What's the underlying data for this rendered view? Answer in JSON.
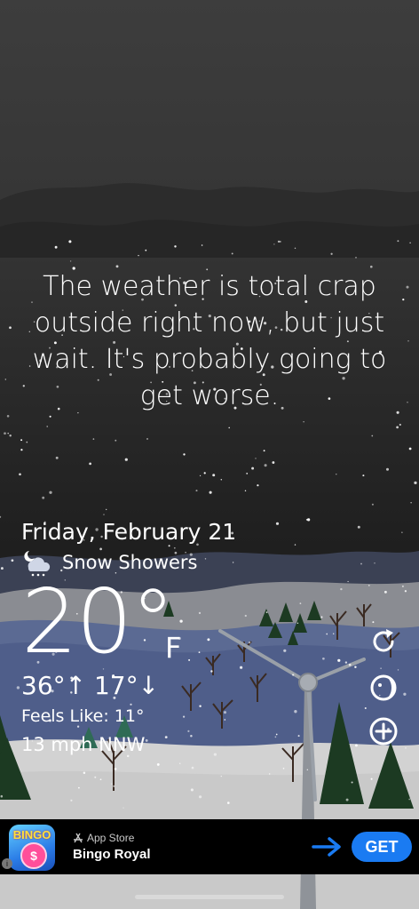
{
  "quote": "The weather is total crap outside right now, but just wait. It's probably going to get worse.",
  "weather": {
    "date": "Friday, February 21",
    "condition": "Snow Showers",
    "condition_icon": "cloud-moon-snow-icon",
    "temperature": "20°",
    "unit": "F",
    "high_low": "36°↑  17°↓",
    "feels_like": "Feels Like: 11°",
    "wind": "13 mph NNW"
  },
  "side_buttons": [
    "refresh-icon",
    "moon-phase-icon",
    "add-icon"
  ],
  "ad": {
    "app_icon_text": "BINGO",
    "app_icon_ball": "$",
    "store": "App Store",
    "name": "Bingo Royal",
    "cta": "GET",
    "info": "i"
  },
  "colors": {
    "sky_top": "#3b3b3b",
    "sky_bottom": "#1f1f1f",
    "snow_ground": "#d5d5d5",
    "tree": "#1b3a20",
    "cta": "#1a7bf2"
  }
}
